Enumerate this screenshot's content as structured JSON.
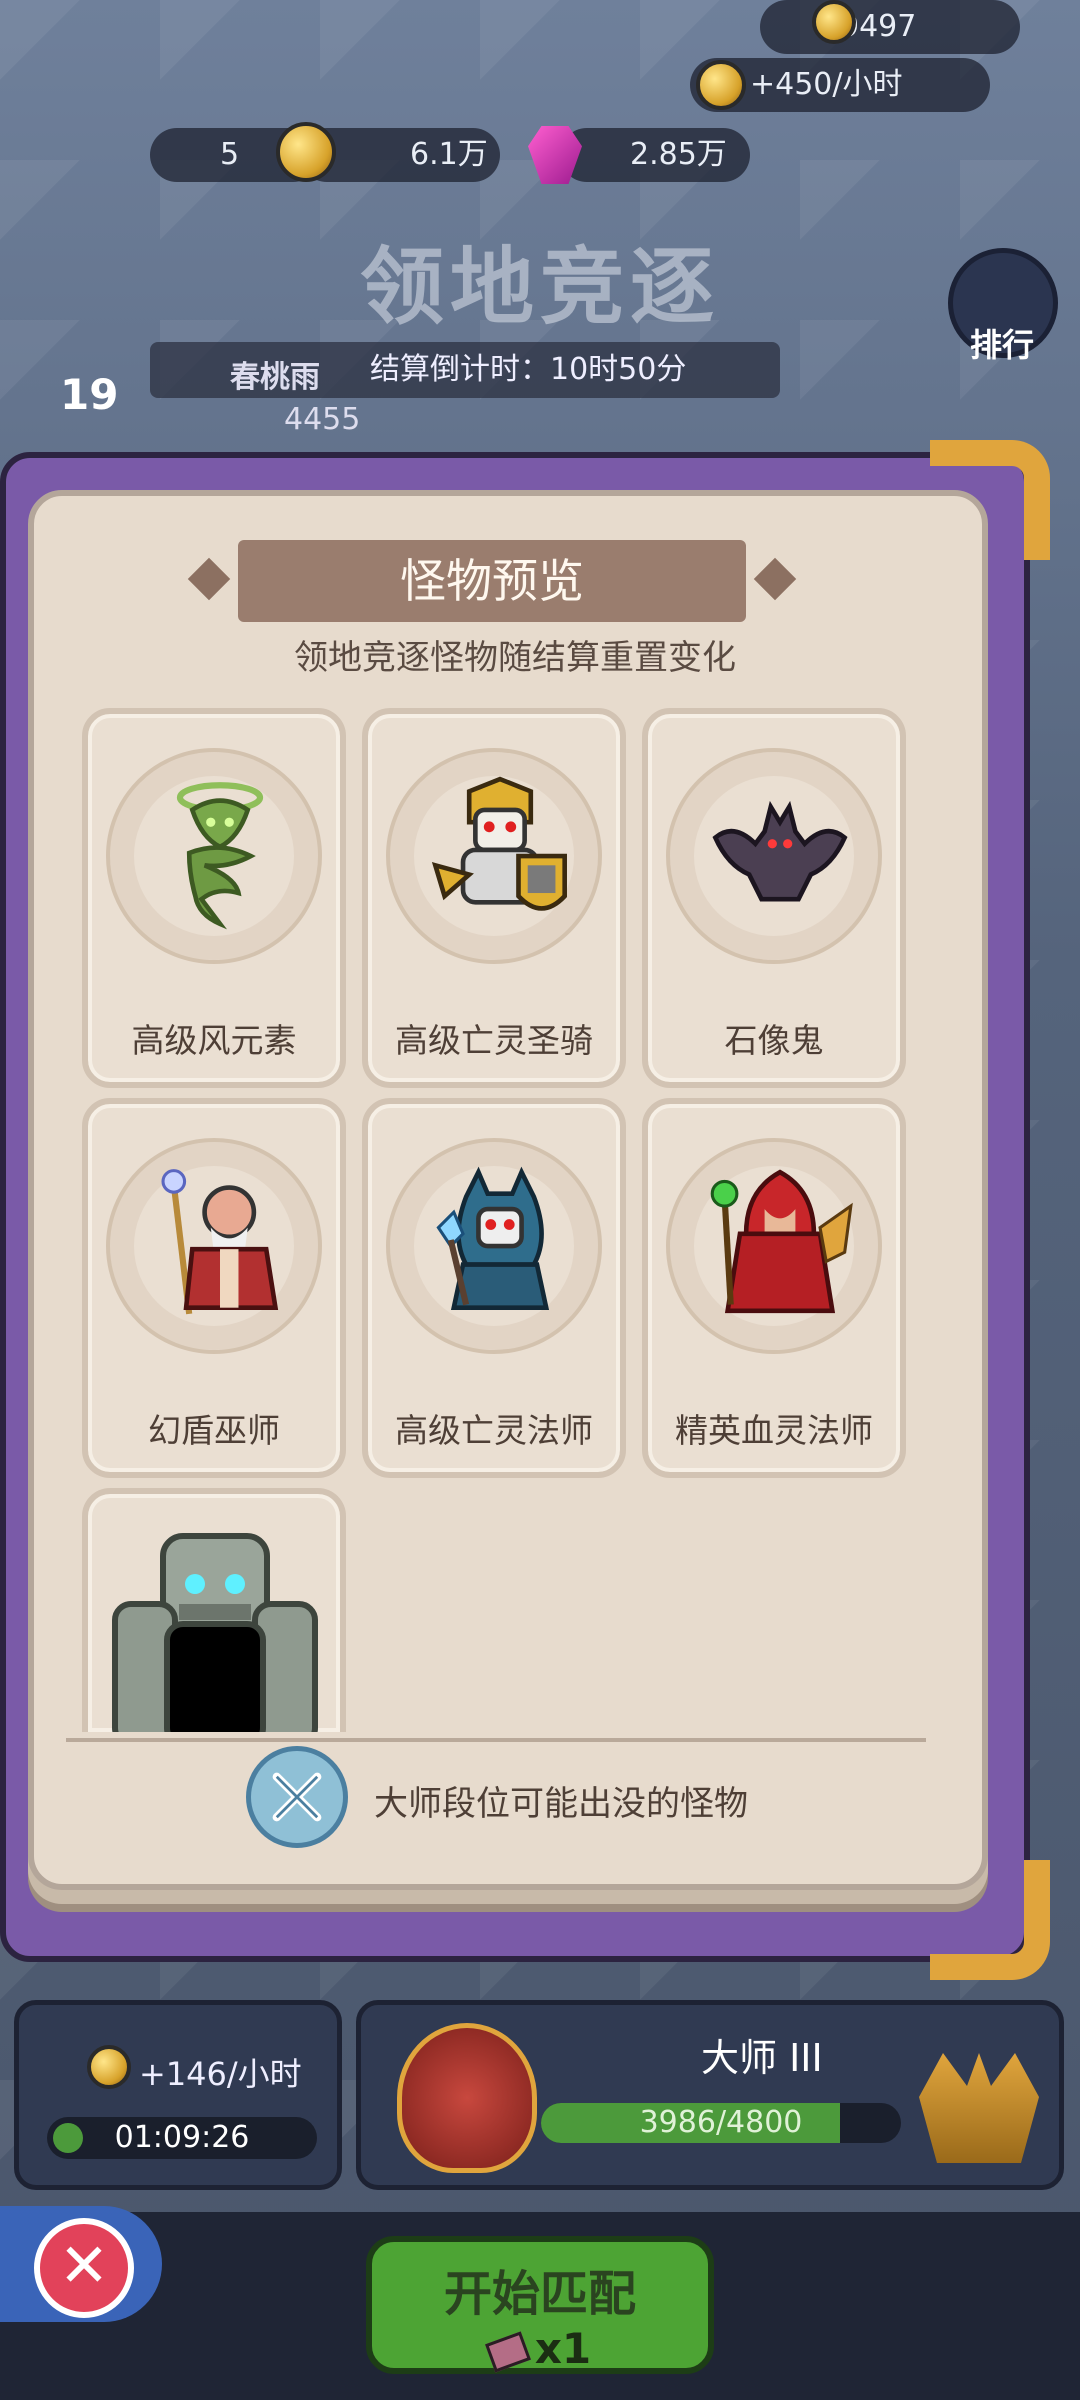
{
  "resources": {
    "trophy_total": "9497",
    "income_rate": "+450/小时",
    "card_count": "5",
    "gold": "6.1万",
    "gems": "2.85万"
  },
  "background": {
    "title": "领地竞逐",
    "player_name": "春桃雨",
    "player_level": "19",
    "player_score": "4455",
    "countdown_label": "结算倒计时：10时50分",
    "side_rank_label": "排行",
    "lower_score": "3986"
  },
  "modal": {
    "title": "怪物预览",
    "subtitle": "领地竞逐怪物随结算重置变化",
    "monsters": [
      {
        "name": "高级风元素",
        "icon": "wind-elemental-icon"
      },
      {
        "name": "高级亡灵圣骑",
        "icon": "undead-paladin-icon"
      },
      {
        "name": "石像鬼",
        "icon": "gargoyle-icon"
      },
      {
        "name": "幻盾巫师",
        "icon": "shield-wizard-icon"
      },
      {
        "name": "高级亡灵法师",
        "icon": "undead-mage-icon"
      },
      {
        "name": "精英血灵法师",
        "icon": "blood-mage-icon"
      },
      {
        "name": "",
        "icon": "stone-golem-icon"
      }
    ],
    "footer_text": "大师段位可能出没的怪物"
  },
  "bottom": {
    "territory_income": "+146/小时",
    "territory_timer": "01:09:26",
    "rank_name": "大师 III",
    "rank_progress_text": "3986/4800",
    "rank_progress_fraction": 0.83,
    "start_label": "开始匹配",
    "start_cost": "x1"
  },
  "colors": {
    "modal_frame": "#7a5aa8",
    "card_bg": "#eadfd2",
    "ribbon": "#9a7d6e",
    "start_button": "#4da434",
    "close_button": "#e2425a"
  }
}
